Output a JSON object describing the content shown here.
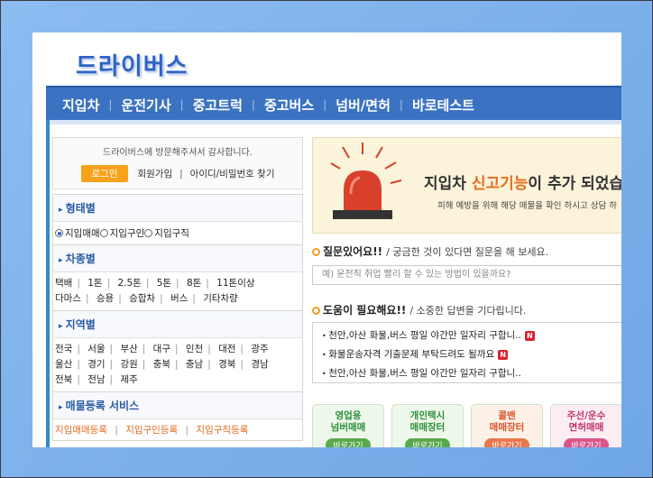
{
  "site": {
    "logo": "드라이버스"
  },
  "nav": {
    "items": [
      "지입차",
      "운전기사",
      "중고트럭",
      "중고버스",
      "넘버/면허",
      "바로테스트"
    ]
  },
  "login": {
    "welcome": "드라이버스에 방문해주셔서 감사합니다.",
    "login_button": "로그인",
    "signup": "회원가입",
    "find": "아이디/비밀번호 찾기"
  },
  "sections": {
    "type": {
      "title": "형태별",
      "options": [
        "지입매매",
        "지입구인",
        "지입구직"
      ],
      "selected": "지입매매"
    },
    "vehicle": {
      "title": "차종별",
      "row1": [
        "택배",
        "1톤",
        "2.5톤",
        "5톤",
        "8톤",
        "11톤이상"
      ],
      "row2": [
        "다마스",
        "승용",
        "승합차",
        "버스",
        "기타차량"
      ]
    },
    "region": {
      "title": "지역별",
      "row1": [
        "전국",
        "서울",
        "부산",
        "대구",
        "인천",
        "대전",
        "광주"
      ],
      "row2": [
        "울산",
        "경기",
        "강원",
        "충북",
        "충남",
        "경북",
        "경남"
      ],
      "row3": [
        "전북",
        "전남",
        "제주"
      ]
    },
    "registration": {
      "title": "매물등록 서비스",
      "links": [
        "지입매매등록",
        "지입구인등록",
        "지입구직등록"
      ]
    }
  },
  "banner": {
    "headline_prefix": "지입차 ",
    "headline_highlight": "신고기능",
    "headline_suffix": "이 추가 되었습",
    "sub": "피해 예방을 위해 해당 매물을 확인 하시고 상담 하",
    "colors": {
      "highlight": "#e66d1c",
      "siren": "#d9402b"
    }
  },
  "question": {
    "title": "질문있어요!!",
    "desc": "/ 궁금한 것이 있다면 질문을 해 보세요.",
    "placeholder": "예) 운전직 취업 빨리 할 수 있는 방법이 있을까요?"
  },
  "help": {
    "title": "도움이 필요해요!!",
    "desc": "/ 소중한 답변을 기다립니다.",
    "items": [
      {
        "text": "천안,아산 화물,버스 평일 야간만 일자리 구합니..",
        "new": "N"
      },
      {
        "text": "화물운송자격 기출문제 부탁드려도 될까요",
        "new": "N"
      },
      {
        "text": "천안,아산 화물,버스 평일 야간만 일자리 구합니..",
        "new": ""
      }
    ]
  },
  "cards": [
    {
      "line1": "영업용",
      "line2": "넘버매매",
      "go": "바로가기",
      "color": "#2c8f3a",
      "bg": "#eef8ea",
      "btn": "#5aaa4d"
    },
    {
      "line1": "개인택시",
      "line2": "매매장터",
      "go": "바로가기",
      "color": "#2c8f3a",
      "bg": "#eef8ea",
      "btn": "#5aaa4d"
    },
    {
      "line1": "콜밴",
      "line2": "매매장터",
      "go": "바로가기",
      "color": "#d9532b",
      "bg": "#fdf0e6",
      "btn": "#e8774a"
    },
    {
      "line1": "주선/운수",
      "line2": "면허매매",
      "go": "바로가기",
      "color": "#c2336b",
      "bg": "#fcedf3",
      "btn": "#d9568c"
    }
  ]
}
